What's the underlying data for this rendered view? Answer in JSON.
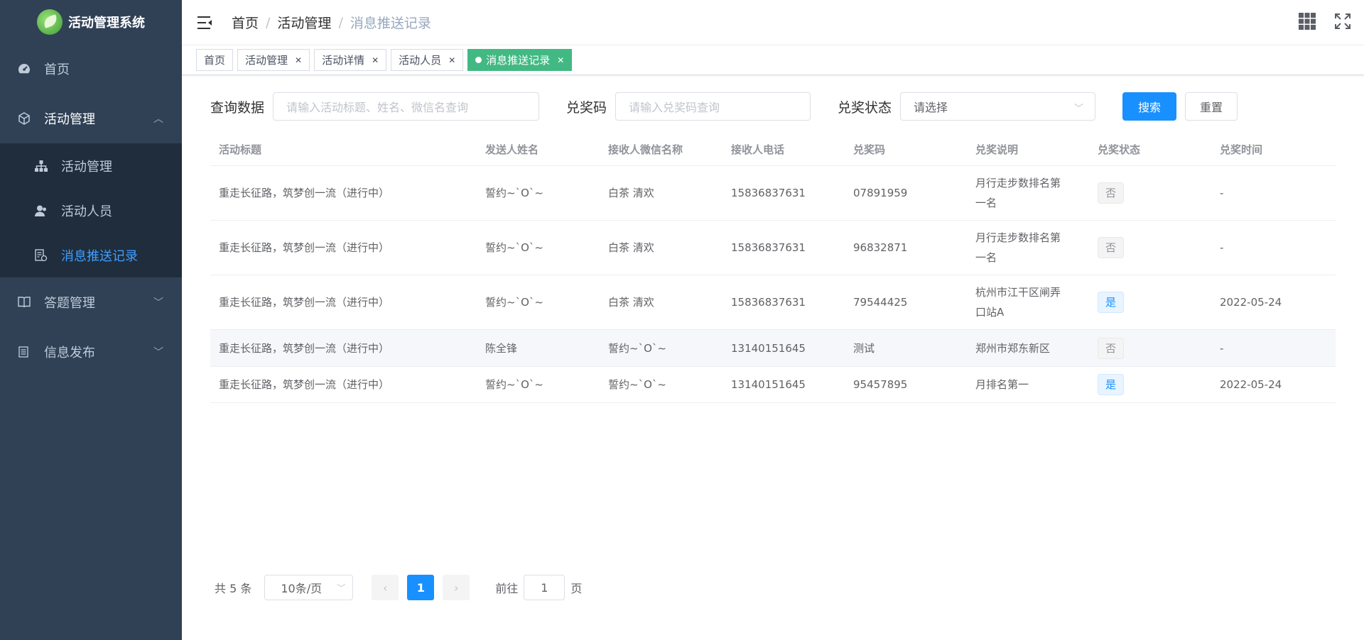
{
  "app": {
    "title": "活动管理系统"
  },
  "sidebar": {
    "items": [
      {
        "label": "首页",
        "icon": "dashboard-icon"
      },
      {
        "label": "活动管理",
        "icon": "cube-icon",
        "open": true,
        "children": [
          {
            "label": "活动管理",
            "icon": "tree-icon"
          },
          {
            "label": "活动人员",
            "icon": "user-icon"
          },
          {
            "label": "消息推送记录",
            "icon": "document-icon",
            "active": true
          }
        ]
      },
      {
        "label": "答题管理",
        "icon": "book-icon"
      },
      {
        "label": "信息发布",
        "icon": "list-icon"
      }
    ]
  },
  "breadcrumb": [
    "首页",
    "活动管理",
    "消息推送记录"
  ],
  "tags": [
    {
      "label": "首页",
      "closable": false
    },
    {
      "label": "活动管理",
      "closable": true
    },
    {
      "label": "活动详情",
      "closable": true
    },
    {
      "label": "活动人员",
      "closable": true
    },
    {
      "label": "消息推送记录",
      "closable": true,
      "active": true
    }
  ],
  "filter": {
    "query_label": "查询数据",
    "query_placeholder": "请输入活动标题、姓名、微信名查询",
    "code_label": "兑奖码",
    "code_placeholder": "请输入兑奖码查询",
    "status_label": "兑奖状态",
    "status_value": "请选择",
    "search_btn": "搜索",
    "reset_btn": "重置"
  },
  "table": {
    "headers": [
      "活动标题",
      "发送人姓名",
      "接收人微信名称",
      "接收人电话",
      "兑奖码",
      "兑奖说明",
      "兑奖状态",
      "兑奖时间"
    ],
    "rows": [
      [
        "重走长征路，筑梦创一流（进行中）",
        "誓约~`O`~",
        "白茶 清欢",
        "15836837631",
        "07891959",
        "月行走步数排名第一名",
        "否",
        "-"
      ],
      [
        "重走长征路，筑梦创一流（进行中）",
        "誓约~`O`~",
        "白茶 清欢",
        "15836837631",
        "96832871",
        "月行走步数排名第一名",
        "否",
        "-"
      ],
      [
        "重走长征路，筑梦创一流（进行中）",
        "誓约~`O`~",
        "白茶 清欢",
        "15836837631",
        "79544425",
        "杭州市江干区闸弄口站A",
        "是",
        "2022-05-24"
      ],
      [
        "重走长征路，筑梦创一流（进行中）",
        "陈全锋",
        "誓约~`O`~",
        "13140151645",
        "测试",
        "郑州市郑东新区",
        "否",
        "-"
      ],
      [
        "重走长征路，筑梦创一流（进行中）",
        "誓约~`O`~",
        "誓约~`O`~",
        "13140151645",
        "95457895",
        "月排名第一",
        "是",
        "2022-05-24"
      ]
    ]
  },
  "pagination": {
    "total_text": "共 5 条",
    "page_size": "10条/页",
    "current": "1",
    "goto_label": "前往",
    "goto_value": "1",
    "page_suffix": "页"
  }
}
